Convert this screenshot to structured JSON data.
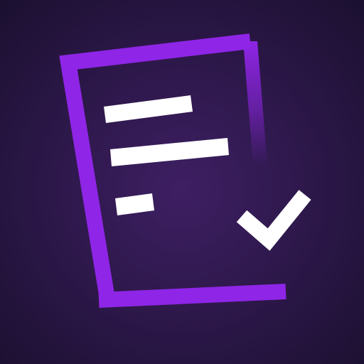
{
  "icon": {
    "name": "document-checklist-icon",
    "colors": {
      "background_center": "#3e1f63",
      "background_edge": "#1b1030",
      "document_outline": "#8f25e6",
      "text_lines": "#ffffff",
      "checkmark": "#ffffff"
    },
    "document_lines": [
      {
        "label": "line-1"
      },
      {
        "label": "line-2"
      },
      {
        "label": "line-3"
      }
    ]
  }
}
